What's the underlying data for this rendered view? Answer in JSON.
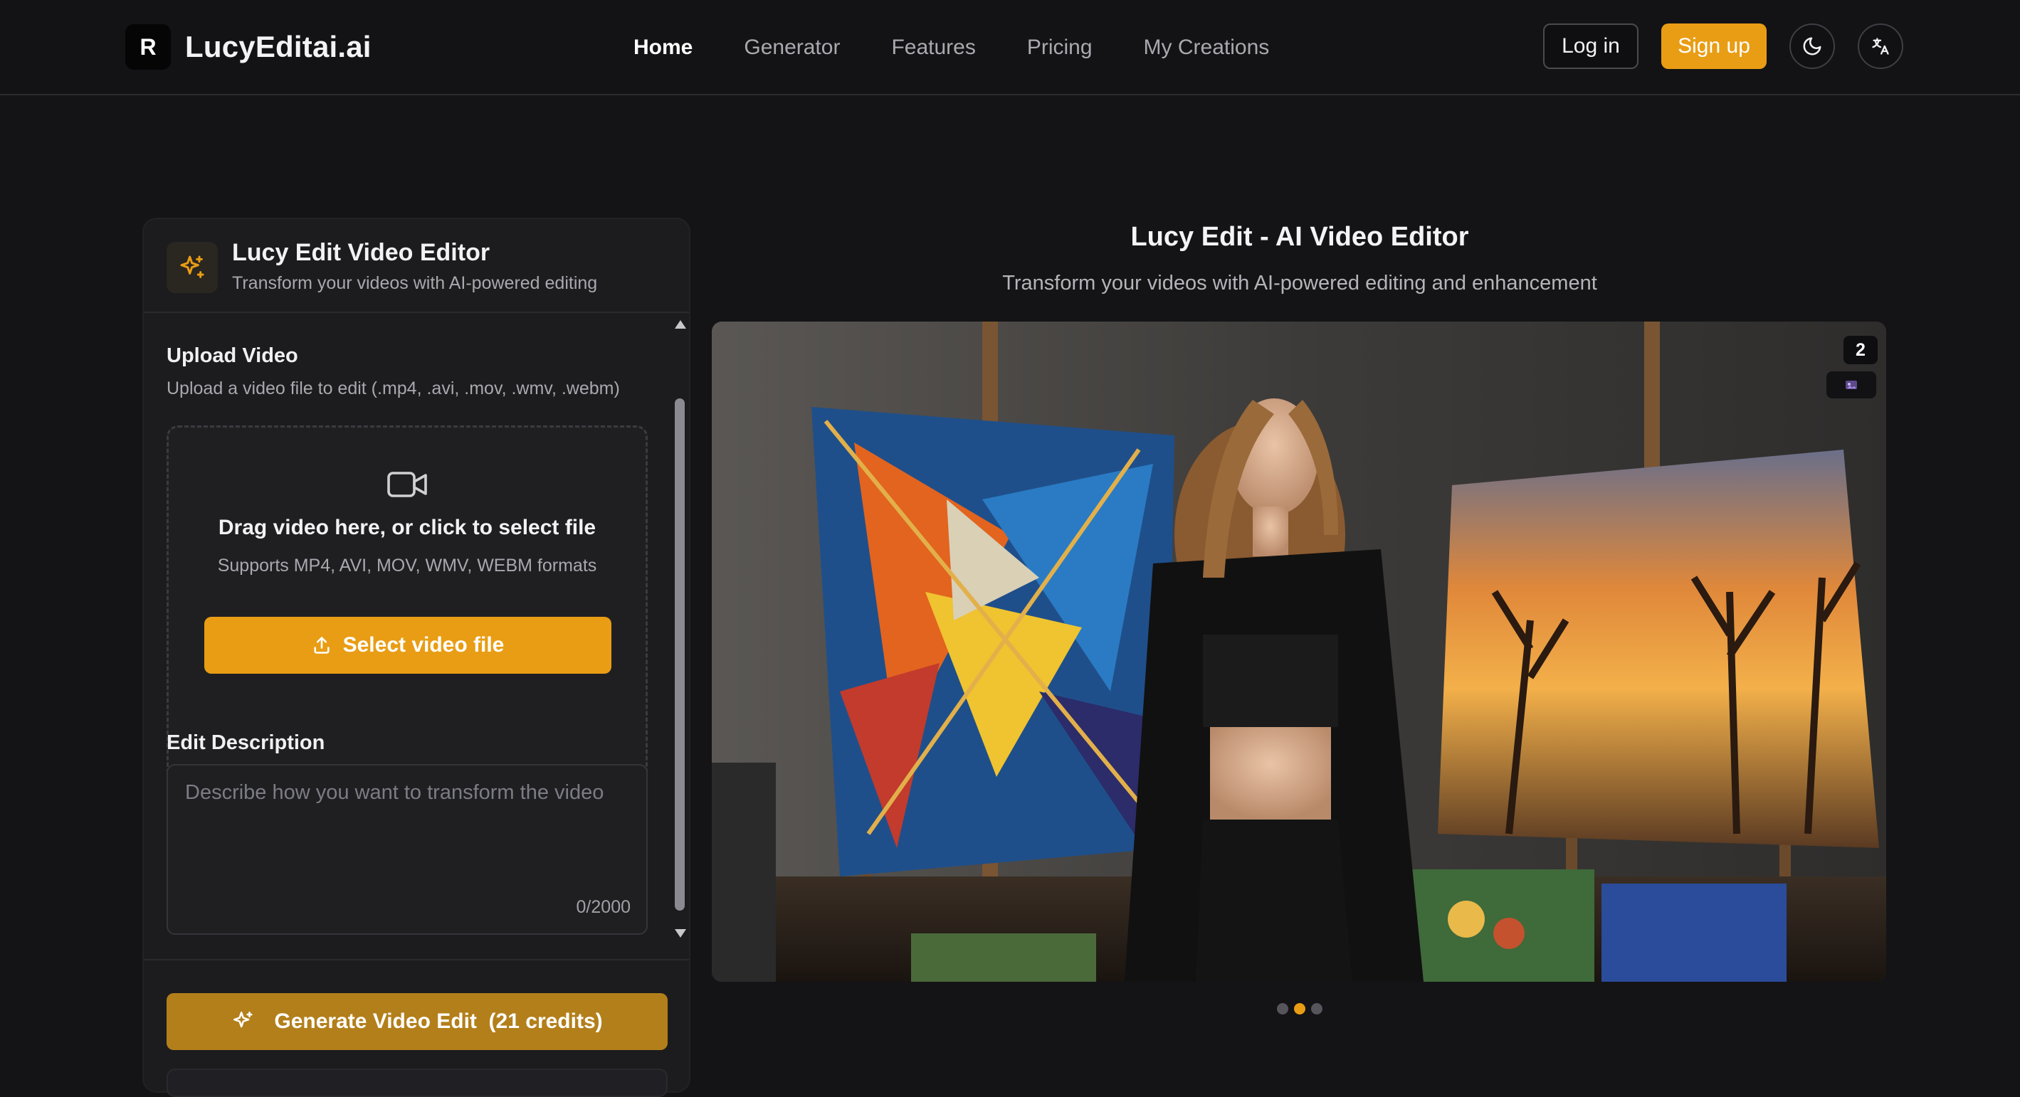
{
  "header": {
    "brand_initial": "R",
    "brand_name": "LucyEditai.ai",
    "nav": [
      {
        "label": "Home",
        "active": true
      },
      {
        "label": "Generator",
        "active": false
      },
      {
        "label": "Features",
        "active": false
      },
      {
        "label": "Pricing",
        "active": false
      },
      {
        "label": "My Creations",
        "active": false
      }
    ],
    "login_label": "Log in",
    "signup_label": "Sign up",
    "theme_icon": "moon-icon",
    "language_icon": "translate-icon"
  },
  "panel": {
    "icon": "sparkles-icon",
    "title": "Lucy Edit Video Editor",
    "subtitle": "Transform your videos with AI-powered editing",
    "upload": {
      "label": "Upload Video",
      "hint": "Upload a video file to edit (.mp4, .avi, .mov, .wmv, .webm)",
      "dropzone_icon": "video-camera-icon",
      "dropzone_title": "Drag video here, or click to select file",
      "dropzone_formats": "Supports MP4, AVI, MOV, WMV, WEBM formats",
      "select_button": "Select video file"
    },
    "description": {
      "label": "Edit Description",
      "placeholder": "Describe how you want to transform the video",
      "value": "",
      "counter": "0/2000"
    },
    "generate_button": "Generate Video Edit  (21 credits)"
  },
  "hero": {
    "title": "Lucy Edit - AI Video Editor",
    "subtitle": "Transform your videos with AI-powered editing and enhancement"
  },
  "preview": {
    "badge_count": "2",
    "slide_count": 3,
    "active_slide_index": 1
  },
  "colors": {
    "accent": "#e99d14",
    "generate_button": "#b37f1a",
    "background": "#141416",
    "panel": "#1c1c1f"
  }
}
